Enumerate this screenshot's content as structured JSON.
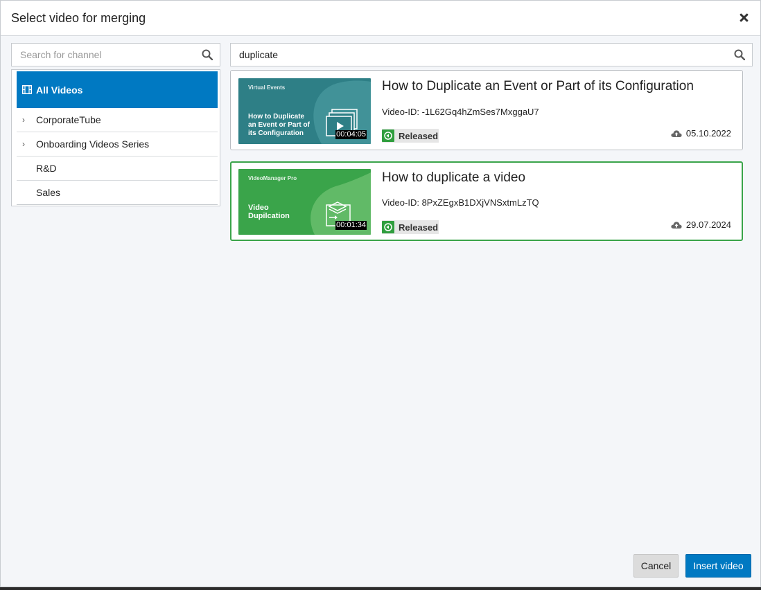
{
  "dialog": {
    "title": "Select video for merging"
  },
  "channel_search": {
    "placeholder": "Search for channel",
    "value": ""
  },
  "video_search": {
    "placeholder": "",
    "value": "duplicate"
  },
  "channels": {
    "all_videos": "All Videos",
    "items": [
      {
        "label": "CorporateTube",
        "expandable": true
      },
      {
        "label": "Onboarding Videos Series",
        "expandable": true
      },
      {
        "label": "R&D",
        "expandable": false
      },
      {
        "label": "Sales",
        "expandable": false
      }
    ]
  },
  "videos": [
    {
      "title": "How to Duplicate an Event or Part of its Configuration",
      "video_id_label": "Video-ID: ",
      "video_id": "-1L62Gq4hZmSes7MxggaU7",
      "status": "Released",
      "date": "05.10.2022",
      "duration": "00:04:05",
      "thumb_brand": "Virtual Events",
      "thumb_title": "How to Duplicate an Event or Part of its Configuration",
      "thumb_color": "#2e7f86",
      "selected": false
    },
    {
      "title": "How to duplicate a video",
      "video_id_label": "Video-ID: ",
      "video_id": "8PxZEgxB1DXjVNSxtmLzTQ",
      "status": "Released",
      "date": "29.07.2024",
      "duration": "00:01:34",
      "thumb_brand": "VideoManager Pro",
      "thumb_title": "Video Dupilcation",
      "thumb_color": "#3aa44a",
      "selected": true
    }
  ],
  "footer": {
    "cancel_label": "Cancel",
    "insert_label": "Insert video"
  },
  "colors": {
    "primary": "#0079c2",
    "selected_border": "#3aa44a",
    "released": "#2f9e3e"
  }
}
